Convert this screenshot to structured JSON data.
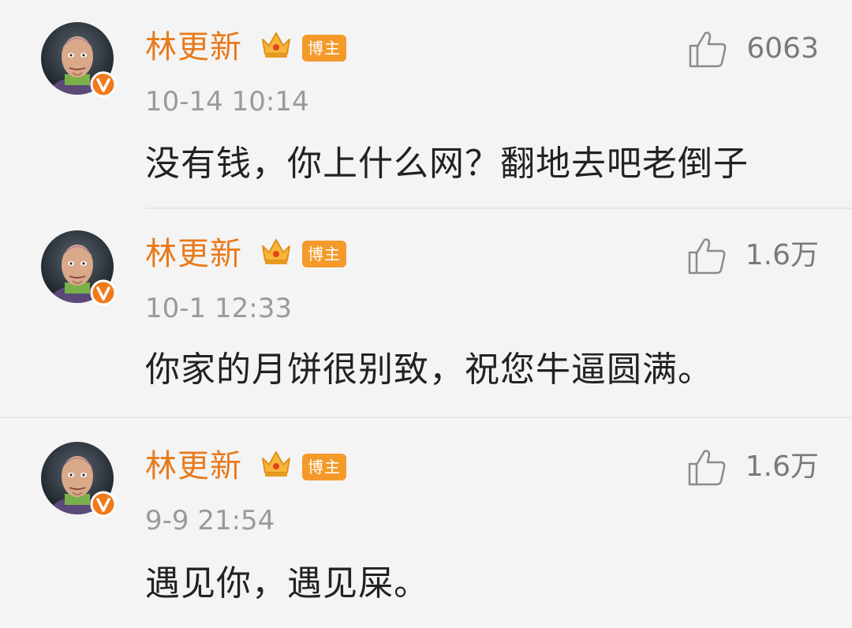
{
  "colors": {
    "name": "#e87a1a",
    "badge_bg": "#f39a2b",
    "verified": "#f07a1a",
    "text": "#222222",
    "meta": "#9a9a9a",
    "background": "#f4f4f4"
  },
  "comments": [
    {
      "username": "林更新",
      "badge": "博主",
      "like_icon": "thumbs-up-icon",
      "likes": "6063",
      "time": "10-14 10:14",
      "text": "没有钱，你上什么网？翻地去吧老倒子"
    },
    {
      "username": "林更新",
      "badge": "博主",
      "like_icon": "thumbs-up-icon",
      "likes": "1.6万",
      "time": "10-1 12:33",
      "text": "你家的月饼很别致，祝您牛逼圆满。"
    },
    {
      "username": "林更新",
      "badge": "博主",
      "like_icon": "thumbs-up-icon",
      "likes": "1.6万",
      "time": "9-9 21:54",
      "text": "遇见你，遇见屎。"
    }
  ]
}
